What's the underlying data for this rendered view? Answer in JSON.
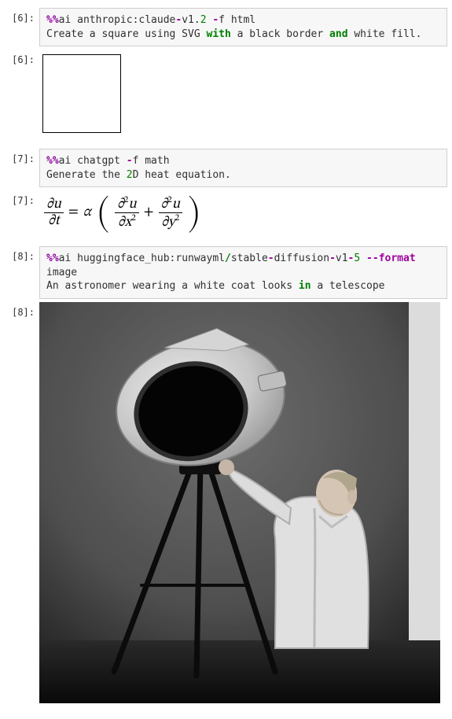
{
  "cells": [
    {
      "prompt_in": "[6]:",
      "input_tokens": [
        {
          "t": "%%",
          "c": "tok-magic"
        },
        {
          "t": "ai anthropic:claude",
          "c": "tok-plain"
        },
        {
          "t": "-",
          "c": "tok-dash"
        },
        {
          "t": "v1",
          "c": "tok-plain"
        },
        {
          "t": ".",
          "c": "tok-punct"
        },
        {
          "t": "2",
          "c": "tok-num"
        },
        {
          "t": " ",
          "c": "tok-plain"
        },
        {
          "t": "-",
          "c": "tok-dash"
        },
        {
          "t": "f html",
          "c": "tok-plain"
        },
        {
          "t": "\n",
          "c": ""
        },
        {
          "t": "Create a square using SVG ",
          "c": "tok-plain"
        },
        {
          "t": "with",
          "c": "tok-key"
        },
        {
          "t": " a black border ",
          "c": "tok-plain"
        },
        {
          "t": "and",
          "c": "tok-key"
        },
        {
          "t": " white fill.",
          "c": "tok-plain"
        }
      ],
      "prompt_out": "[6]:",
      "output_kind": "svg_square"
    },
    {
      "prompt_in": "[7]:",
      "input_tokens": [
        {
          "t": "%%",
          "c": "tok-magic"
        },
        {
          "t": "ai chatgpt ",
          "c": "tok-plain"
        },
        {
          "t": "-",
          "c": "tok-dash"
        },
        {
          "t": "f math",
          "c": "tok-plain"
        },
        {
          "t": "\n",
          "c": ""
        },
        {
          "t": "Generate the ",
          "c": "tok-plain"
        },
        {
          "t": "2",
          "c": "tok-num"
        },
        {
          "t": "D heat equation.",
          "c": "tok-plain"
        }
      ],
      "prompt_out": "[7]:",
      "output_kind": "math_heat",
      "math": {
        "lhs_num": "∂u",
        "lhs_den": "∂t",
        "eq": "=",
        "alpha": "α",
        "term1_num": "∂²u",
        "term1_den": "∂x²",
        "plus": "+",
        "term2_num": "∂²u",
        "term2_den": "∂y²"
      }
    },
    {
      "prompt_in": "[8]:",
      "input_tokens": [
        {
          "t": "%%",
          "c": "tok-magic"
        },
        {
          "t": "ai huggingface_hub:runwayml",
          "c": "tok-plain"
        },
        {
          "t": "/",
          "c": "tok-key"
        },
        {
          "t": "stable",
          "c": "tok-plain"
        },
        {
          "t": "-",
          "c": "tok-dash"
        },
        {
          "t": "diffusion",
          "c": "tok-plain"
        },
        {
          "t": "-",
          "c": "tok-dash"
        },
        {
          "t": "v1",
          "c": "tok-plain"
        },
        {
          "t": "-",
          "c": "tok-dash"
        },
        {
          "t": "5",
          "c": "tok-num"
        },
        {
          "t": " ",
          "c": "tok-plain"
        },
        {
          "t": "--",
          "c": "tok-opt"
        },
        {
          "t": "format",
          "c": "tok-opt"
        },
        {
          "t": " image",
          "c": "tok-plain"
        },
        {
          "t": "\n",
          "c": ""
        },
        {
          "t": "An astronomer wearing a white coat looks ",
          "c": "tok-plain"
        },
        {
          "t": "in",
          "c": "tok-key"
        },
        {
          "t": " a telescope",
          "c": "tok-plain"
        }
      ],
      "prompt_out": "[8]:",
      "output_kind": "gen_image",
      "image_alt": "An astronomer wearing a white coat looks in a telescope"
    }
  ]
}
